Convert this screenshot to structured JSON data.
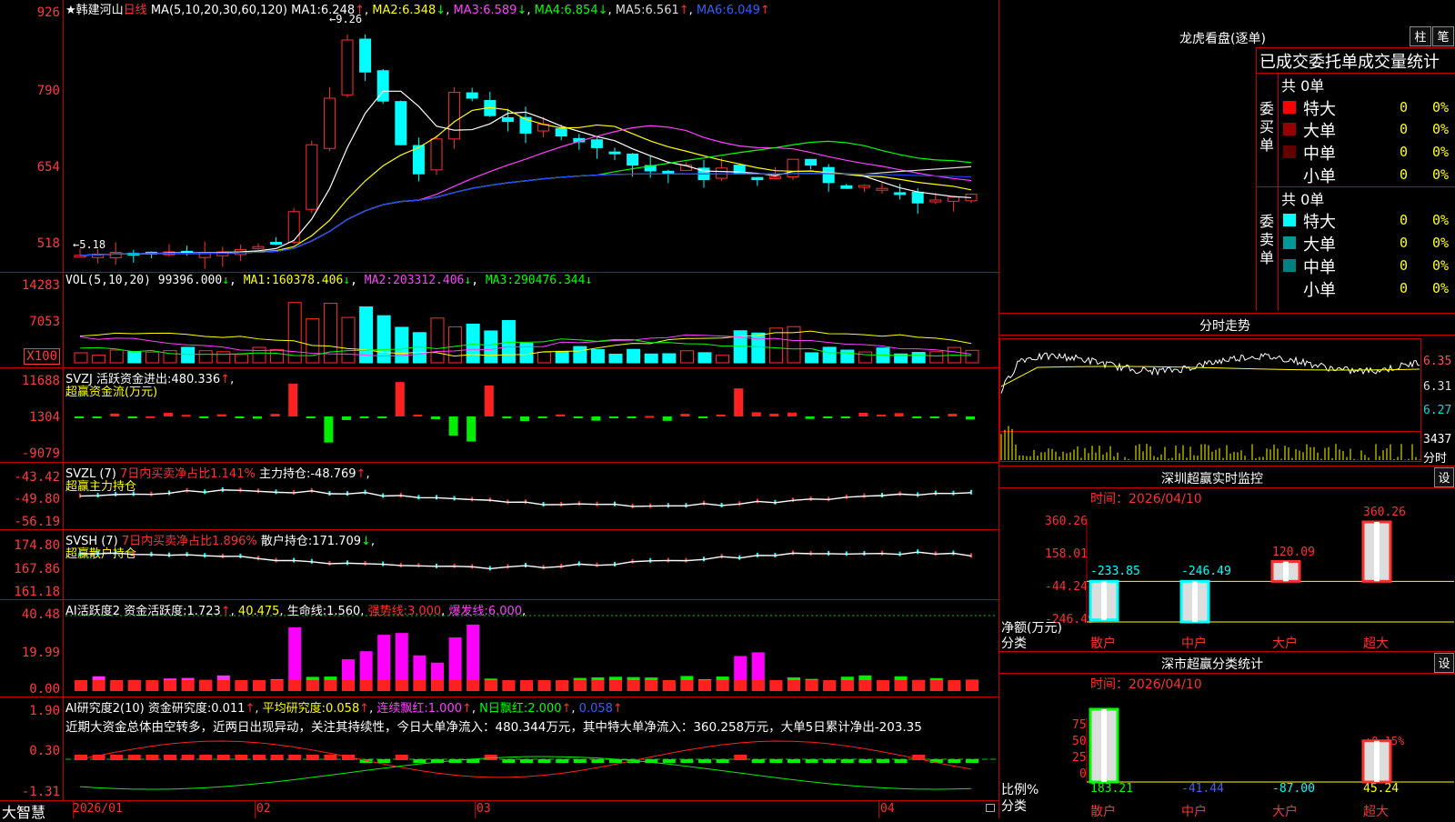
{
  "stock": {
    "name": "韩建河山",
    "period": "日线",
    "ma_label": "MA(5,10,20,30,60,120)",
    "ma": [
      {
        "label": "MA1:",
        "value": "6.248",
        "arrow": "↑"
      },
      {
        "label": "MA2:",
        "value": "6.348",
        "arrow": "↓"
      },
      {
        "label": "MA3:",
        "value": "6.589",
        "arrow": "↓"
      },
      {
        "label": "MA4:",
        "value": "6.854",
        "arrow": "↓"
      },
      {
        "label": "MA5:",
        "value": "6.561",
        "arrow": "↑"
      },
      {
        "label": "MA6:",
        "value": "6.049",
        "arrow": "↑"
      }
    ],
    "high_mark": "9.26",
    "low_mark": "5.18"
  },
  "price_axis": [
    "926",
    "790",
    "654",
    "518"
  ],
  "vol": {
    "header": "VOL(5,10,20)",
    "value": "99396.000",
    "arrow": "↓",
    "ma": [
      {
        "label": "MA1:",
        "value": "160378.406",
        "arrow": "↓"
      },
      {
        "label": "MA2:",
        "value": "203312.406",
        "arrow": "↓"
      },
      {
        "label": "MA3:",
        "value": "290476.344",
        "arrow": "↓"
      }
    ],
    "axis": [
      "14283",
      "7053",
      "X100"
    ]
  },
  "svzj": {
    "header": "SVZJ",
    "label": "活跃资金进出:",
    "value": "480.336",
    "arrow": "↑",
    "sub": "超赢资金流(万元)",
    "axis": [
      "11688",
      "1304",
      "-9079"
    ]
  },
  "svzl": {
    "header": "SVZL (7)",
    "ratio": "7日内买卖净占比1.141%",
    "label": "主力持仓:",
    "value": "-48.769",
    "arrow": "↑",
    "sub": "超赢主力持仓",
    "axis": [
      "-43.42",
      "-49.80",
      "-56.19"
    ]
  },
  "svsh": {
    "header": "SVSH (7)",
    "ratio": "7日内买卖净占比1.896%",
    "label": "散户持仓:",
    "value": "171.709",
    "arrow": "↓",
    "sub": "超赢散户持仓",
    "axis": [
      "174.80",
      "167.86",
      "161.18"
    ]
  },
  "ai1": {
    "header": "AI活跃度2",
    "label": "资金活跃度:",
    "v1": "1.723",
    "a1": "↑",
    "v2": "40.475",
    "l2": "生命线:",
    "v3": "1.560",
    "l3": "强势线:",
    "v4": "3.000",
    "l4": "爆发线:",
    "v5": "6.000",
    "axis": [
      "40.48",
      "19.99",
      "0.00"
    ]
  },
  "ai2": {
    "header": "AI研究度2(10)",
    "label": "资金研究度:",
    "v1": "0.011",
    "a1": "↑",
    "l2": "平均研究度:",
    "v2": "0.058",
    "a2": "↑",
    "l3": "连续飘红:",
    "v3": "1.000",
    "a3": "↑",
    "l4": "N日飘红:",
    "v4": "2.000",
    "a4": "↑",
    "v5": "0.058",
    "a5": "↑",
    "comment": "近期大资金总体由空转多，近两日出现异动，关注其持续性，今日大单净流入：480.344万元，其中特大单净流入：360.258万元，大单5日累计净出-203.35",
    "axis": [
      "1.90",
      "0.30",
      "-1.31"
    ]
  },
  "dates": [
    "2026/01",
    "02",
    "03",
    "04"
  ],
  "brand": "大智慧",
  "lhb": {
    "title": "龙虎看盘(逐单)",
    "btn1": "柱",
    "btn2": "笔",
    "subtitle": "已成交委托单成交量统计",
    "buy": {
      "side": "委买单",
      "total": "共 0单",
      "rows": [
        {
          "name": "特大",
          "v": "0",
          "p": "0%",
          "c": "#ff0000"
        },
        {
          "name": "大单",
          "v": "0",
          "p": "0%",
          "c": "#990000"
        },
        {
          "name": "中单",
          "v": "0",
          "p": "0%",
          "c": "#660000"
        },
        {
          "name": "小单",
          "v": "0",
          "p": "0%",
          "c": "#000000"
        }
      ]
    },
    "sell": {
      "side": "委卖单",
      "total": "共 0单",
      "rows": [
        {
          "name": "特大",
          "v": "0",
          "p": "0%",
          "c": "#00ffff"
        },
        {
          "name": "大单",
          "v": "0",
          "p": "0%",
          "c": "#009999"
        },
        {
          "name": "中单",
          "v": "0",
          "p": "0%",
          "c": "#008080"
        },
        {
          "name": "小单",
          "v": "0",
          "p": "0%",
          "c": "#000000"
        }
      ]
    }
  },
  "fenshi": {
    "title": "分时走势",
    "axis": [
      "6.35",
      "6.31",
      "6.27"
    ],
    "vol_label": "3437",
    "unit": "分时"
  },
  "monitor": {
    "title": "深圳超赢实时监控",
    "btn": "设",
    "time": "时间：2026/04/10",
    "axis": [
      "360.26",
      "158.01",
      "-44.24",
      "-246.49"
    ],
    "ylabel": "净额(万元)",
    "xlabel": "分类",
    "categories": [
      "散户",
      "中户",
      "大户",
      "超大"
    ],
    "values": [
      "-233.85",
      "-246.49",
      "120.09",
      "360.26"
    ]
  },
  "stats": {
    "title": "深市超赢分类统计",
    "btn": "设",
    "time": "时间：2026/04/10",
    "axis": [
      "75",
      "50",
      "25",
      "0"
    ],
    "ylabel": "比例%",
    "xlabel": "分类",
    "categories": [
      "散户",
      "中户",
      "大户",
      "超大"
    ],
    "values": [
      "183.21",
      "-41.44",
      "-87.00",
      "45.24"
    ],
    "pct": "+0.15%"
  },
  "chart_data": [
    {
      "type": "bar",
      "title": "深圳超赢实时监控",
      "categories": [
        "散户",
        "中户",
        "大户",
        "超大"
      ],
      "values": [
        -233.85,
        -246.49,
        120.09,
        360.26
      ],
      "ylabel": "净额(万元)",
      "xlabel": "分类",
      "ylim": [
        -246.49,
        360.26
      ]
    },
    {
      "type": "bar",
      "title": "深市超赢分类统计",
      "categories": [
        "散户",
        "中户",
        "大户",
        "超大"
      ],
      "values": [
        183.21,
        -41.44,
        -87.0,
        45.24
      ],
      "ylabel": "比例%",
      "xlabel": "分类",
      "ylim": [
        0,
        75
      ]
    }
  ]
}
